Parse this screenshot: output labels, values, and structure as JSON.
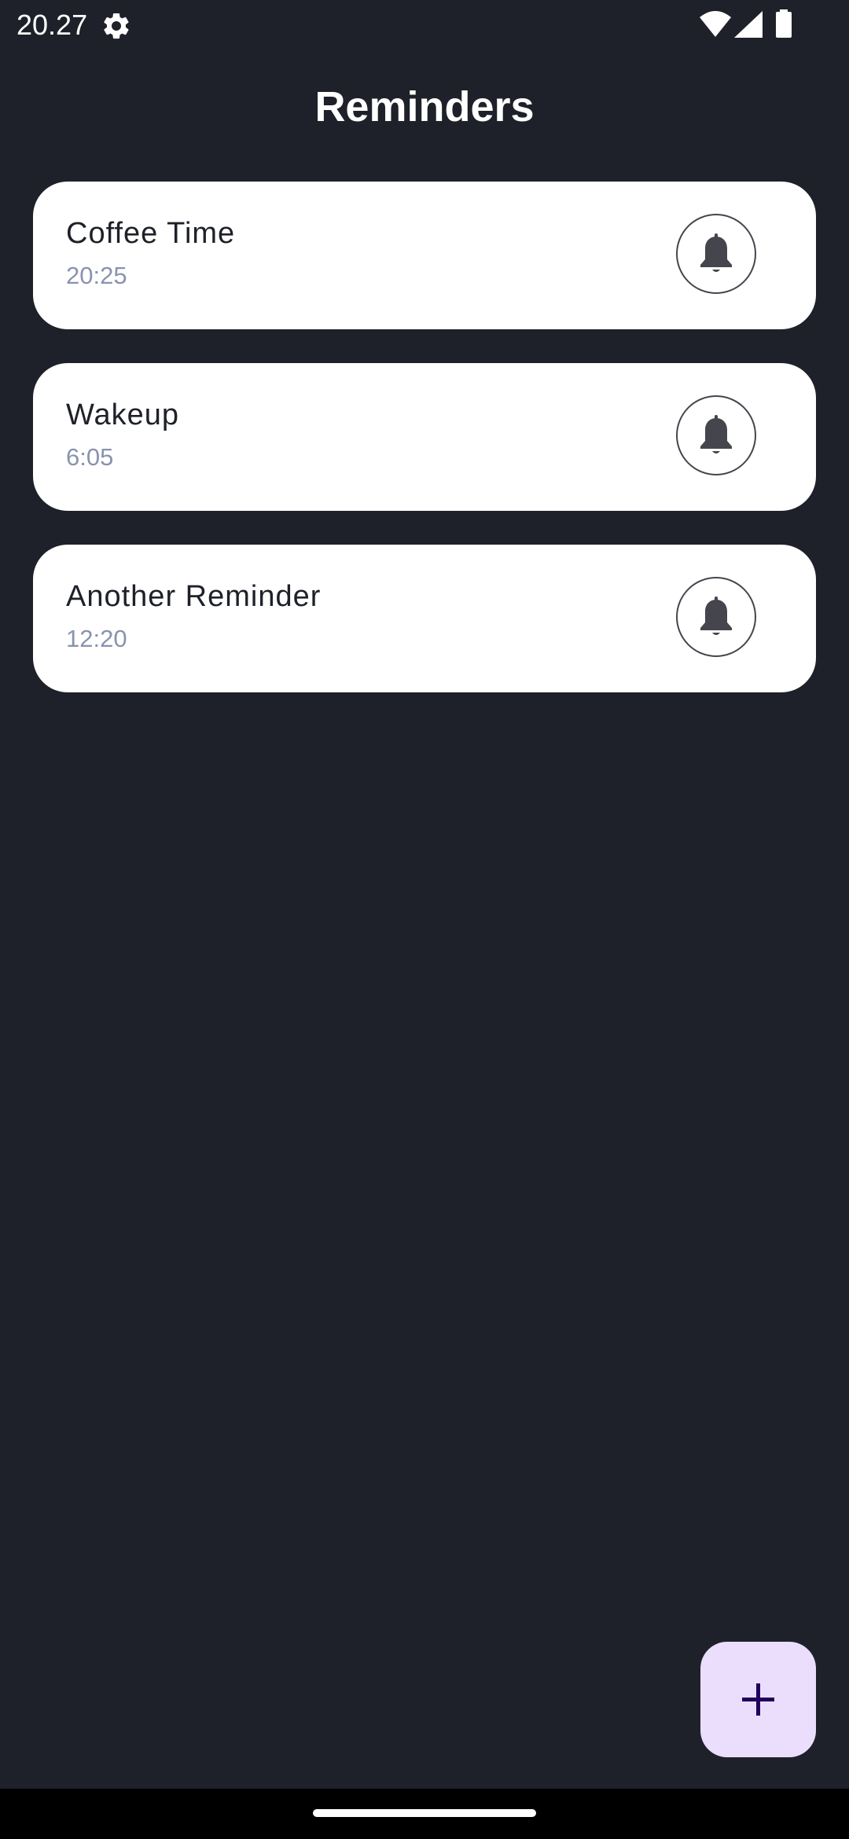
{
  "status_bar": {
    "time": "20.27",
    "icons": [
      "gear-icon",
      "wifi-icon",
      "cellular-signal-icon",
      "battery-icon"
    ]
  },
  "header": {
    "title": "Reminders"
  },
  "reminders": [
    {
      "title": "Coffee Time",
      "time": "20:25",
      "icon": "bell-icon"
    },
    {
      "title": "Wakeup",
      "time": "6:05",
      "icon": "bell-icon"
    },
    {
      "title": "Another Reminder",
      "time": "12:20",
      "icon": "bell-icon"
    }
  ],
  "fab": {
    "icon": "plus-icon"
  },
  "colors": {
    "background": "#1e2129",
    "card": "#ffffff",
    "title_text": "#1e2129",
    "time_text": "#8993ad",
    "bell": "#45454e",
    "fab_background": "#ebdefc",
    "fab_icon": "#21005d"
  }
}
